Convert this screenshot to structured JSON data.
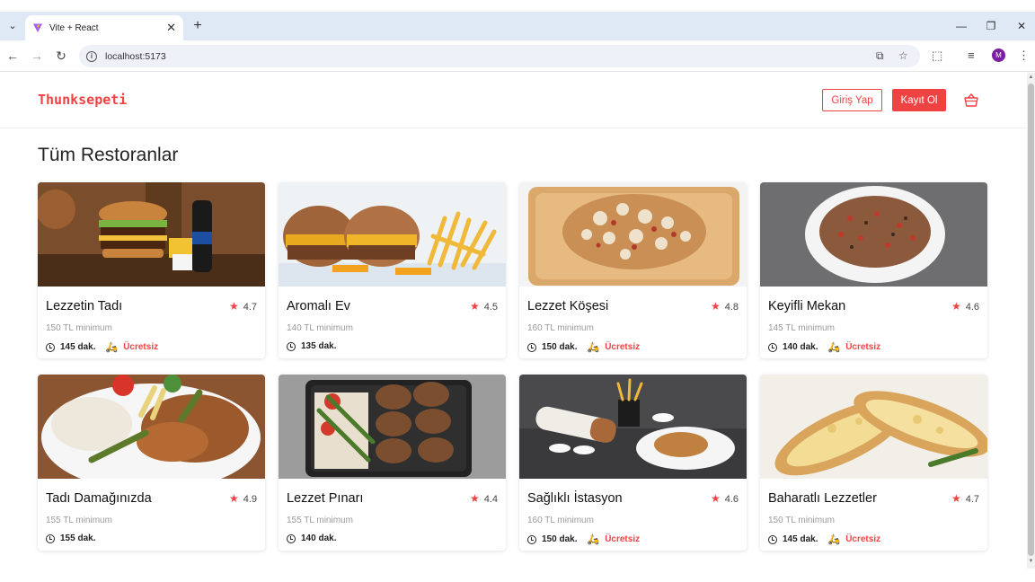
{
  "browser": {
    "tab_title": "Vite + React",
    "url": "localhost:5173",
    "profile_initial": "M"
  },
  "header": {
    "logo": "Thunksepeti",
    "login_label": "Giriş Yap",
    "register_label": "Kayıt Ol"
  },
  "page_title": "Tüm Restoranlar",
  "restaurants": [
    {
      "name": "Lezzetin Tadı",
      "rating": "4.7",
      "minimum": "150 TL minimum",
      "time": "145 dak.",
      "delivery": "Ücretsiz"
    },
    {
      "name": "Aromalı Ev",
      "rating": "4.5",
      "minimum": "140 TL minimum",
      "time": "135 dak.",
      "delivery": ""
    },
    {
      "name": "Lezzet Köşesi",
      "rating": "4.8",
      "minimum": "160 TL minimum",
      "time": "150 dak.",
      "delivery": "Ücretsiz"
    },
    {
      "name": "Keyifli Mekan",
      "rating": "4.6",
      "minimum": "145 TL minimum",
      "time": "140 dak.",
      "delivery": "Ücretsiz"
    },
    {
      "name": "Tadı Damağınızda",
      "rating": "4.9",
      "minimum": "155 TL minimum",
      "time": "155 dak.",
      "delivery": ""
    },
    {
      "name": "Lezzet Pınarı",
      "rating": "4.4",
      "minimum": "155 TL minimum",
      "time": "140 dak.",
      "delivery": ""
    },
    {
      "name": "Sağlıklı İstasyon",
      "rating": "4.6",
      "minimum": "160 TL minimum",
      "time": "150 dak.",
      "delivery": "Ücretsiz"
    },
    {
      "name": "Baharatlı Lezzetler",
      "rating": "4.7",
      "minimum": "150 TL minimum",
      "time": "145 dak.",
      "delivery": "Ücretsiz"
    }
  ],
  "colors": {
    "accent": "#ef4343",
    "tabbar": "#dfe8f5",
    "omnibox": "#eef1f8"
  },
  "icons": {
    "star": "star-icon",
    "clock": "clock-icon",
    "delivery": "motorcycle-icon",
    "cart": "basket-icon"
  }
}
